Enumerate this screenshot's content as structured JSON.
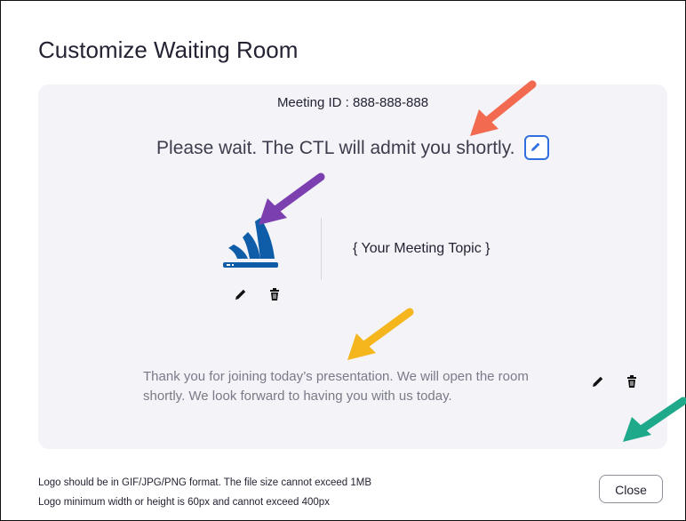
{
  "title": "Customize Waiting Room",
  "preview": {
    "meeting_id": "Meeting ID : 888-888-888",
    "wait_message": "Please wait. The CTL will admit you shortly.",
    "topic": "{ Your Meeting Topic }",
    "description": "Thank you for joining today’s presentation. We will open the room shortly. We look forward to having you with us today."
  },
  "footer": {
    "note_line1": "Logo should be in GIF/JPG/PNG format. The file size cannot exceed 1MB",
    "note_line2": "Logo minimum width or height is 60px and cannot exceed 400px",
    "close_label": "Close"
  },
  "colors": {
    "accent": "#2f6fe0",
    "logo_blue": "#0f5da8",
    "arrow_red": "#f26a4f",
    "arrow_purple": "#7b3fb0",
    "arrow_yellow": "#f5b51c",
    "arrow_teal": "#1ea98b"
  },
  "icons": [
    "pencil-icon",
    "trash-icon",
    "edit-icon",
    "logo-image"
  ]
}
